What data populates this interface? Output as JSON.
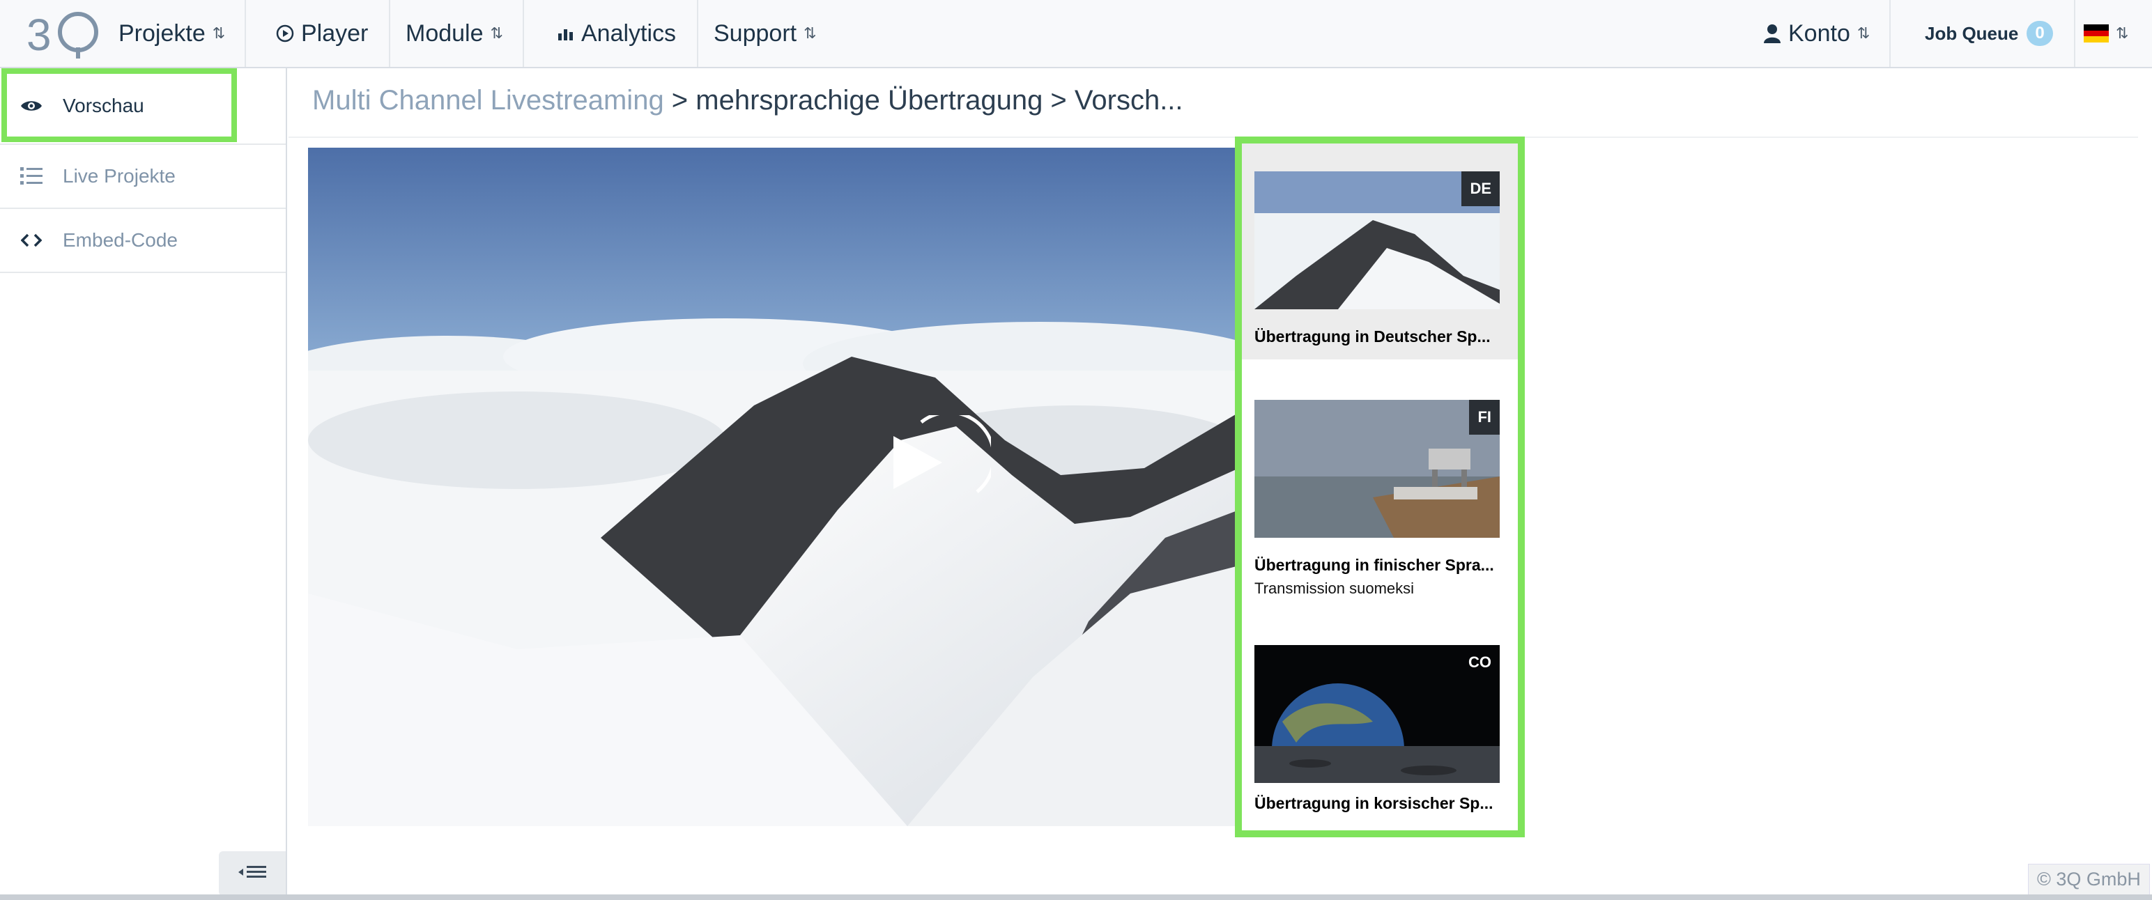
{
  "nav": {
    "projekte": "Projekte",
    "player": "Player",
    "module": "Module",
    "analytics": "Analytics",
    "support": "Support",
    "konto": "Konto",
    "job_queue": "Job Queue",
    "job_queue_count": "0",
    "caret_glyph": "⇅"
  },
  "sidebar": {
    "items": [
      {
        "label": "Vorschau",
        "icon": "eye-icon"
      },
      {
        "label": "Live Projekte",
        "icon": "list-icon"
      },
      {
        "label": "Embed-Code",
        "icon": "code-icon"
      }
    ]
  },
  "breadcrumb": {
    "link": "Multi Channel Livestreaming",
    "rest": " > mehrsprachige Übertragung > Vorsch..."
  },
  "playlist": [
    {
      "tag": "DE",
      "title": "Übertragung in Deutscher Sp...",
      "subtitle": ""
    },
    {
      "tag": "FI",
      "title": "Übertragung in finischer Spra...",
      "subtitle": "Transmission suomeksi"
    },
    {
      "tag": "CO",
      "title": "Übertragung in korsischer Sp...",
      "subtitle": ""
    }
  ],
  "footer": {
    "copyright": "© 3Q GmbH"
  },
  "colors": {
    "highlight": "#7fe35b",
    "navy": "#1d3347",
    "muted": "#8ea3b9"
  }
}
